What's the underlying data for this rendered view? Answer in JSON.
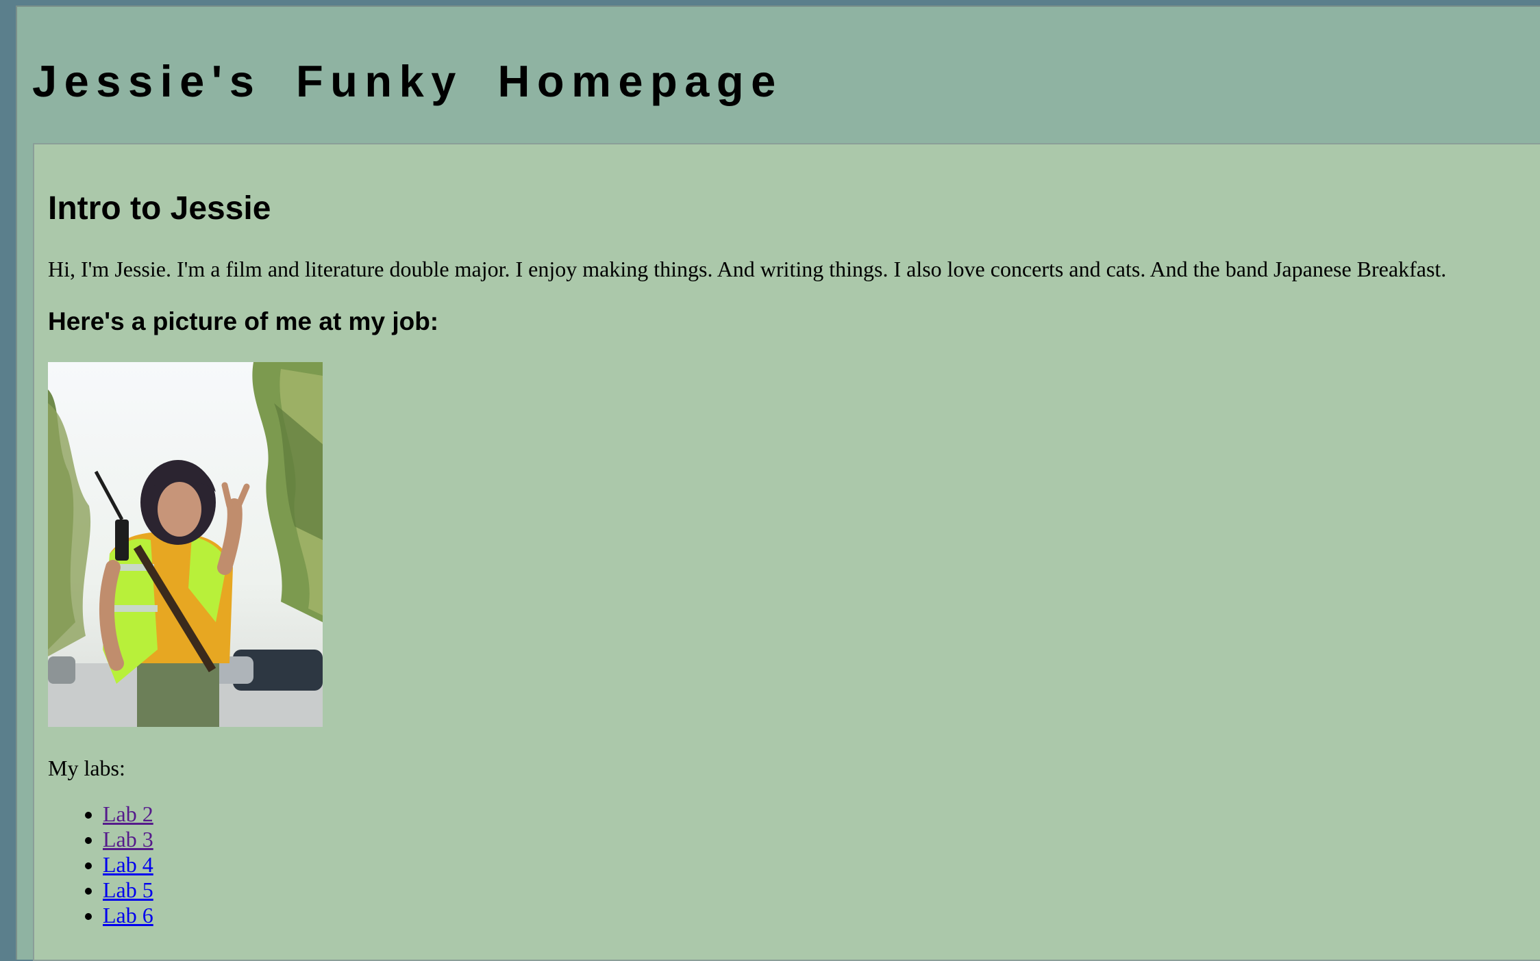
{
  "header": {
    "title": "Jessie's Funky Homepage"
  },
  "intro": {
    "heading": "Intro to Jessie",
    "text": "Hi, I'm Jessie. I'm a film and literature double major. I enjoy making things. And writing things. I also love concerts and cats. And the band Japanese Breakfast."
  },
  "picture": {
    "heading": "Here's a picture of me at my job:"
  },
  "labs": {
    "label": "My labs:",
    "items": [
      {
        "label": "Lab 2",
        "visited": true
      },
      {
        "label": "Lab 3",
        "visited": true
      },
      {
        "label": "Lab 4",
        "visited": false
      },
      {
        "label": "Lab 5",
        "visited": false
      },
      {
        "label": "Lab 6",
        "visited": false
      }
    ]
  },
  "colors": {
    "outer_background": "#5b7f8c",
    "header_background": "#8fb3a2",
    "content_background": "#abc8aa",
    "link": "#0000ee",
    "visited_link": "#551a8b"
  }
}
